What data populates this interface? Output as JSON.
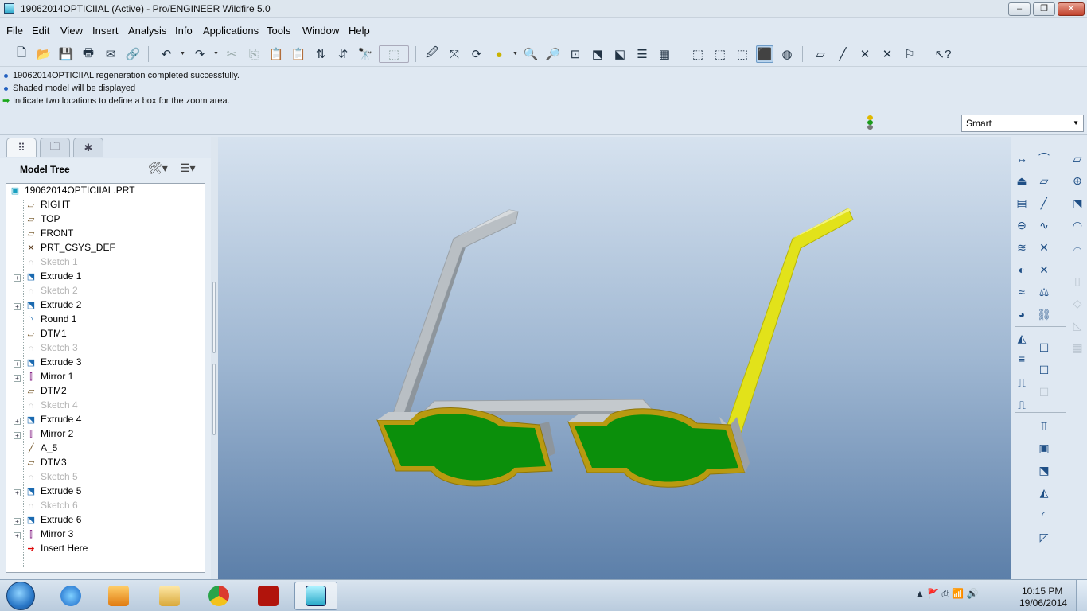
{
  "window": {
    "title": "19062014OPTICIIAL (Active) - Pro/ENGINEER Wildfire 5.0",
    "min_label": "–",
    "max_label": "❐",
    "close_label": "✕"
  },
  "menu": [
    "File",
    "Edit",
    "View",
    "Insert",
    "Analysis",
    "Info",
    "Applications",
    "Tools",
    "Window",
    "Help"
  ],
  "messages": [
    "19062014OPTICIIAL regeneration completed successfully.",
    "Shaded model will be displayed",
    "Indicate two locations to define a box for the zoom area."
  ],
  "filter": {
    "value": "Smart"
  },
  "model_tree": {
    "title": "Model Tree",
    "root": "19062014OPTICIIAL.PRT",
    "items": [
      {
        "label": "RIGHT",
        "icon": "datum-plane-icon",
        "dim": false,
        "expandable": false
      },
      {
        "label": "TOP",
        "icon": "datum-plane-icon",
        "dim": false,
        "expandable": false
      },
      {
        "label": "FRONT",
        "icon": "datum-plane-icon",
        "dim": false,
        "expandable": false
      },
      {
        "label": "PRT_CSYS_DEF",
        "icon": "csys-icon",
        "dim": false,
        "expandable": false
      },
      {
        "label": "Sketch 1",
        "icon": "sketch-icon",
        "dim": true,
        "expandable": false
      },
      {
        "label": "Extrude 1",
        "icon": "extrude-icon",
        "dim": false,
        "expandable": true
      },
      {
        "label": "Sketch 2",
        "icon": "sketch-icon",
        "dim": true,
        "expandable": false
      },
      {
        "label": "Extrude 2",
        "icon": "extrude-icon",
        "dim": false,
        "expandable": true
      },
      {
        "label": "Round 1",
        "icon": "round-icon",
        "dim": false,
        "expandable": false
      },
      {
        "label": "DTM1",
        "icon": "datum-plane-icon",
        "dim": false,
        "expandable": false
      },
      {
        "label": "Sketch 3",
        "icon": "sketch-icon",
        "dim": true,
        "expandable": false
      },
      {
        "label": "Extrude 3",
        "icon": "extrude-icon",
        "dim": false,
        "expandable": true
      },
      {
        "label": "Mirror 1",
        "icon": "mirror-icon",
        "dim": false,
        "expandable": true
      },
      {
        "label": "DTM2",
        "icon": "datum-plane-icon",
        "dim": false,
        "expandable": false
      },
      {
        "label": "Sketch 4",
        "icon": "sketch-icon",
        "dim": true,
        "expandable": false
      },
      {
        "label": "Extrude 4",
        "icon": "extrude-icon",
        "dim": false,
        "expandable": true
      },
      {
        "label": "Mirror 2",
        "icon": "mirror-icon",
        "dim": false,
        "expandable": true
      },
      {
        "label": "A_5",
        "icon": "datum-axis-icon",
        "dim": false,
        "expandable": false
      },
      {
        "label": "DTM3",
        "icon": "datum-plane-icon",
        "dim": false,
        "expandable": false
      },
      {
        "label": "Sketch 5",
        "icon": "sketch-icon",
        "dim": true,
        "expandable": false
      },
      {
        "label": "Extrude 5",
        "icon": "extrude-icon",
        "dim": false,
        "expandable": true
      },
      {
        "label": "Sketch 6",
        "icon": "sketch-icon",
        "dim": true,
        "expandable": false
      },
      {
        "label": "Extrude 6",
        "icon": "extrude-icon",
        "dim": false,
        "expandable": true
      },
      {
        "label": "Mirror 3",
        "icon": "mirror-icon",
        "dim": false,
        "expandable": true
      },
      {
        "label": "Insert Here",
        "icon": "insert-arrow-icon",
        "dim": false,
        "expandable": false
      }
    ]
  },
  "colors": {
    "lens": "#0b8f0b",
    "frame_rim": "#b99a10",
    "frame_body": "#b9bfc4",
    "temple_right": "#e2e21a",
    "viewport_top": "#d6e2ef",
    "viewport_bottom": "#5c7fa9"
  },
  "taskbar": {
    "apps": [
      "internet-explorer-icon",
      "media-player-icon",
      "file-explorer-icon",
      "chrome-icon",
      "acrobat-icon",
      "proe-icon"
    ],
    "time": "10:15 PM",
    "date": "19/06/2014"
  }
}
